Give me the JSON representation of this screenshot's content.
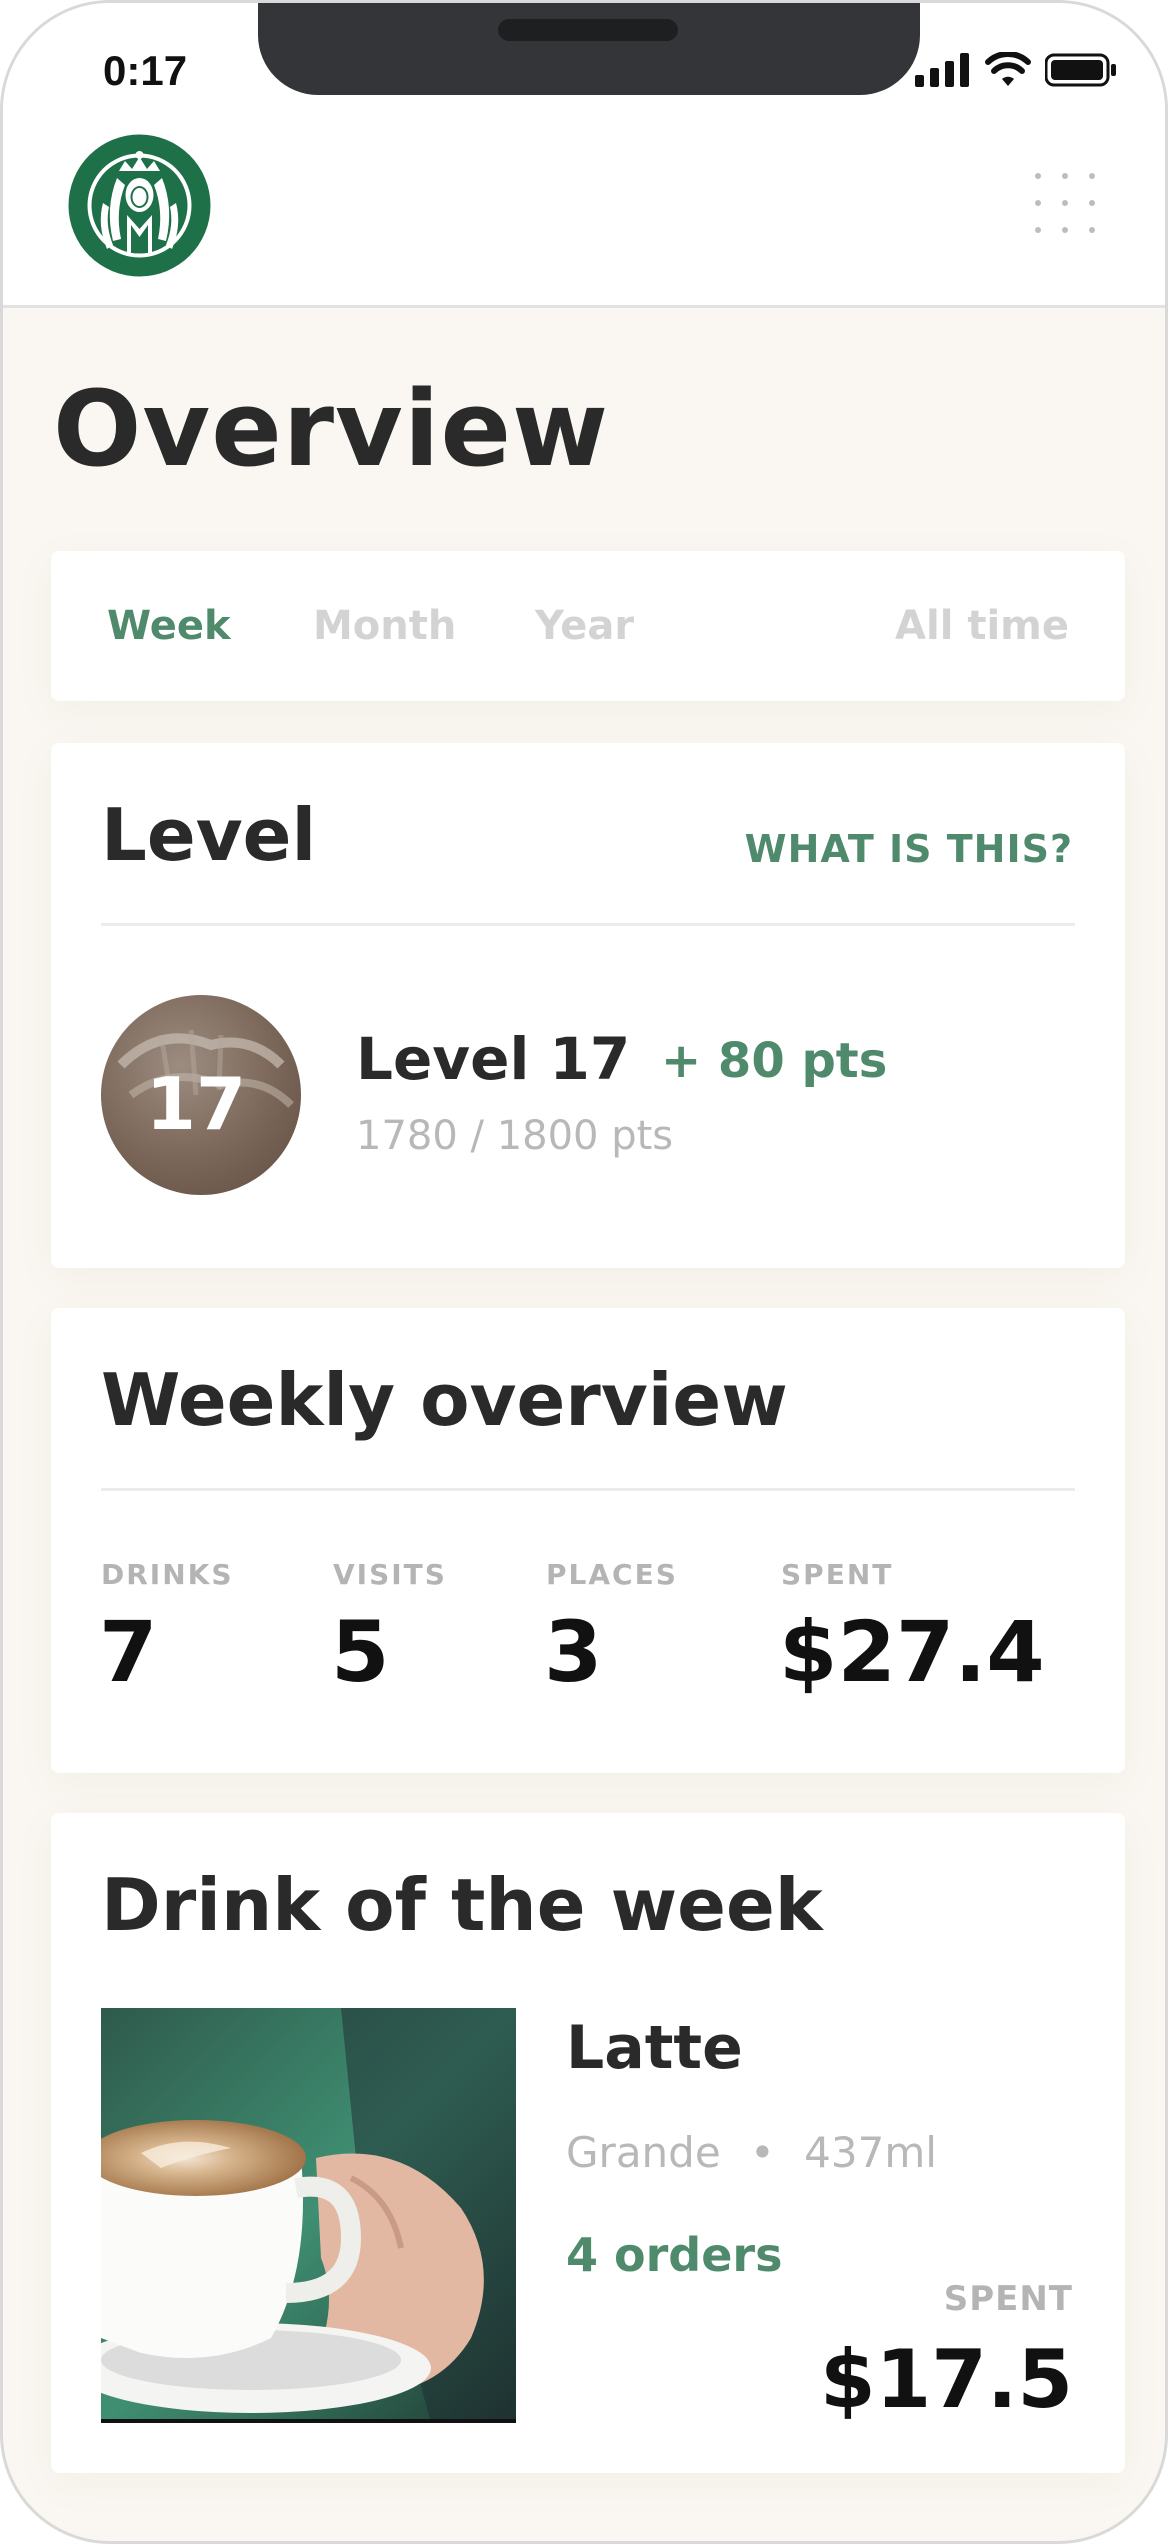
{
  "status_bar": {
    "time": "0:17"
  },
  "header": {
    "logo": "starbucks-logo",
    "menu_icon": "grid-menu-icon"
  },
  "page": {
    "title": "Overview"
  },
  "tabs": [
    {
      "label": "Week",
      "active": true
    },
    {
      "label": "Month",
      "active": false
    },
    {
      "label": "Year",
      "active": false
    },
    {
      "label": "All time",
      "active": false
    }
  ],
  "level": {
    "title": "Level",
    "help_link": "WHAT IS THIS?",
    "badge_number": "17",
    "name": "Level 17",
    "points_gain": "+ 80 pts",
    "progress": "1780 / 1800 pts"
  },
  "weekly": {
    "title": "Weekly overview",
    "stats": [
      {
        "label": "DRINKS",
        "value": "7"
      },
      {
        "label": "VISITS",
        "value": "5"
      },
      {
        "label": "PLACES",
        "value": "3"
      },
      {
        "label": "SPENT",
        "value": "$27.4"
      }
    ]
  },
  "drink": {
    "title": "Drink of the week",
    "name": "Latte",
    "size": "Grande",
    "separator": "•",
    "volume": "437ml",
    "orders": "4 orders",
    "spent_label": "SPENT",
    "spent_value": "$17.5"
  },
  "colors": {
    "accent_green": "#4f8a6d",
    "background": "#faf7f2",
    "logo_green": "#1e7048"
  }
}
